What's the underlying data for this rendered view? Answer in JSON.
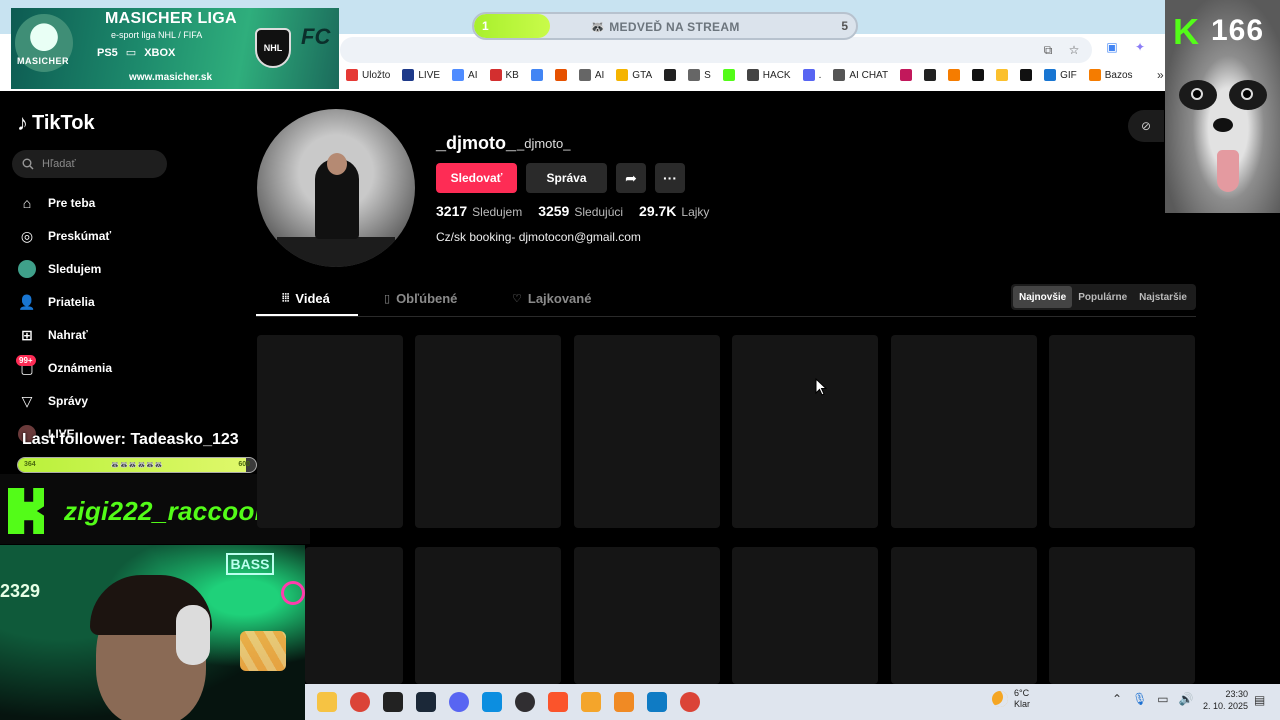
{
  "overlay": {
    "banner": {
      "title": "MASICHER LIGA",
      "subtitle": "e-sport liga NHL / FIFA",
      "mascot_label": "MASICHER",
      "platforms": [
        "PS5",
        "XBOX"
      ],
      "nhl_text": "NHL",
      "fc_text": "FC",
      "url": "www.masicher.sk"
    },
    "goal": {
      "start": "1",
      "end": "5",
      "label": "MEDVEĎ NA STREAM",
      "progress": 0.2
    },
    "kick_counter": {
      "logo": "K",
      "count": "166"
    },
    "last_follower": "Last follower: Tadeasko_123",
    "follower_bar": {
      "start": "364",
      "end": "600",
      "progress": 0.96
    },
    "channel_name": "zigi222_raccoon",
    "webcam": {
      "counter": "2329",
      "sign": "BASS"
    }
  },
  "browser": {
    "bookmarks": [
      {
        "label": "Uložto",
        "icon": "uloz-icon",
        "color": "#e53935"
      },
      {
        "label": "LIVE",
        "icon": "live-icon",
        "color": "#1e3a8a"
      },
      {
        "label": "AI",
        "icon": "gemini-icon",
        "color": "#4f8cff"
      },
      {
        "label": "KB",
        "icon": "kb-icon",
        "color": "#d32f2f"
      },
      {
        "label": "",
        "icon": "translate-icon",
        "color": "#4285f4"
      },
      {
        "label": "",
        "icon": "g-icon",
        "color": "#e65100"
      },
      {
        "label": "AI",
        "icon": "folder-icon",
        "color": "#666"
      },
      {
        "label": "GTA",
        "icon": "gta-icon",
        "color": "#f5b400"
      },
      {
        "label": "",
        "icon": "steam-icon",
        "color": "#222"
      },
      {
        "label": "S",
        "icon": "folder-icon",
        "color": "#666"
      },
      {
        "label": "",
        "icon": "kick-icon",
        "color": "#53fc18"
      },
      {
        "label": "HACK",
        "icon": "hack-icon",
        "color": "#444"
      },
      {
        "label": ".",
        "icon": "discord-icon",
        "color": "#5865f2"
      },
      {
        "label": "AI CHAT",
        "icon": "chat-icon",
        "color": "#555"
      },
      {
        "label": "",
        "icon": "dots-icon",
        "color": "#c2185b"
      },
      {
        "label": "",
        "icon": "globe-icon",
        "color": "#222"
      },
      {
        "label": "",
        "icon": "box-icon",
        "color": "#f57c00"
      },
      {
        "label": "",
        "icon": "ring-icon",
        "color": "#111"
      },
      {
        "label": "",
        "icon": "check-icon",
        "color": "#fbc02d"
      },
      {
        "label": "",
        "icon": "g2-icon",
        "color": "#111"
      },
      {
        "label": "GIF",
        "icon": "gif-icon",
        "color": "#1976d2"
      },
      {
        "label": "Bazos",
        "icon": "bazos-icon",
        "color": "#f57c00"
      }
    ],
    "more": "»"
  },
  "tiktok": {
    "logo": "TikTok",
    "search_placeholder": "Hľadať",
    "nav": [
      {
        "label": "Pre teba",
        "icon": "home-icon"
      },
      {
        "label": "Preskúmať",
        "icon": "compass-icon"
      },
      {
        "label": "Sledujem",
        "icon": "following-avatar-icon"
      },
      {
        "label": "Priatelia",
        "icon": "friends-icon"
      },
      {
        "label": "Nahrať",
        "icon": "upload-icon"
      },
      {
        "label": "Oznámenia",
        "icon": "inbox-icon"
      },
      {
        "label": "Správy",
        "icon": "messages-icon"
      },
      {
        "label": "LIVE",
        "icon": "live-icon"
      }
    ],
    "notif_badge": "99+",
    "profile": {
      "handle": "_djmoto_",
      "nickname": "_djmoto_",
      "follow_label": "Sledovať",
      "message_label": "Správa",
      "stats": [
        {
          "num": "3217",
          "label": "Sledujem"
        },
        {
          "num": "3259",
          "label": "Sledujúci"
        },
        {
          "num": "29.7K",
          "label": "Lajky"
        }
      ],
      "bio": "Cz/sk booking- djmotocon@gmail.com"
    },
    "tabs": [
      {
        "label": "Videá",
        "icon": "grid-icon",
        "active": true
      },
      {
        "label": "Obľúbené",
        "icon": "bookmark-icon",
        "active": false
      },
      {
        "label": "Lajkované",
        "icon": "heart-icon",
        "active": false
      }
    ],
    "sort": [
      {
        "label": "Najnovšie",
        "active": true
      },
      {
        "label": "Populárne",
        "active": false
      },
      {
        "label": "Najstaršie",
        "active": false
      }
    ]
  },
  "taskbar": {
    "apps": [
      {
        "icon": "explorer-icon",
        "color": "#f6c343"
      },
      {
        "icon": "chrome-icon",
        "color": "#db4437"
      },
      {
        "icon": "epic-icon",
        "color": "#222"
      },
      {
        "icon": "steam-icon",
        "color": "#1b2838"
      },
      {
        "icon": "discord-icon",
        "color": "#5865f2"
      },
      {
        "icon": "edge-icon",
        "color": "#0c8ee0"
      },
      {
        "icon": "obs-icon",
        "color": "#302e31"
      },
      {
        "icon": "brave-icon",
        "color": "#fb542b"
      },
      {
        "icon": "app-icon",
        "color": "#f4a52b"
      },
      {
        "icon": "vlc-icon",
        "color": "#f08a24"
      },
      {
        "icon": "window-icon",
        "color": "#0f7bc4"
      },
      {
        "icon": "chrome-alt-icon",
        "color": "#db4437"
      }
    ],
    "weather": {
      "temp": "6°C",
      "desc": "Klar"
    },
    "time": "23:30",
    "date": "2. 10. 2025"
  }
}
